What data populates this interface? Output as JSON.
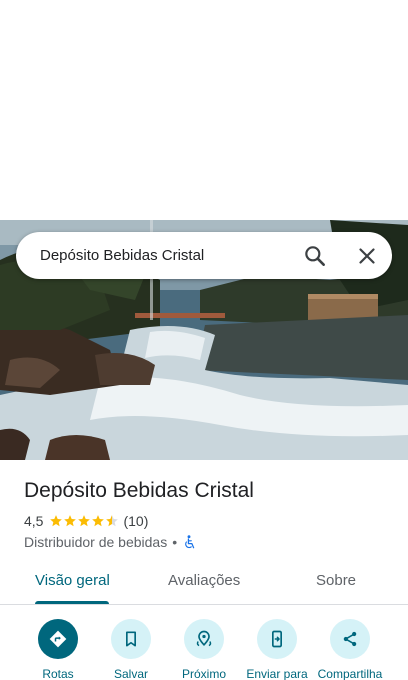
{
  "search": {
    "query": "Depósito Bebidas Cristal"
  },
  "place": {
    "name": "Depósito Bebidas Cristal",
    "rating": "4,5",
    "rating_value": 4.5,
    "review_count": "(10)",
    "category": "Distribuidor de bebidas",
    "separator": "•"
  },
  "tabs": [
    {
      "label": "Visão geral",
      "active": true
    },
    {
      "label": "Avaliações",
      "active": false
    },
    {
      "label": "Sobre",
      "active": false
    }
  ],
  "actions": [
    {
      "label": "Rotas",
      "icon": "directions-icon"
    },
    {
      "label": "Salvar",
      "icon": "bookmark-icon"
    },
    {
      "label": "Próximo",
      "icon": "nearby-icon"
    },
    {
      "label": "Enviar para",
      "icon": "send-to-phone-icon"
    },
    {
      "label": "Compartilha",
      "icon": "share-icon"
    }
  ],
  "colors": {
    "accent": "#00677d",
    "action_bg": "#d5f2f7",
    "star": "#fbbc04",
    "accessibility": "#1a73e8"
  }
}
